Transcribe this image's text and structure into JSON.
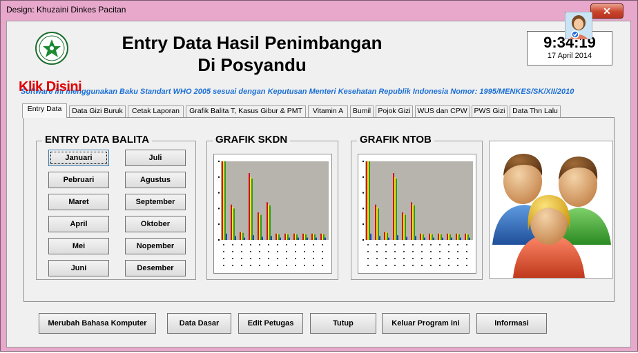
{
  "window": {
    "title": "Design: Khuzaini Dinkes Pacitan",
    "close_label": "✕"
  },
  "header": {
    "title_line1": "Entry Data Hasil Penimbangan",
    "title_line2": "Di Posyandu",
    "clock_time": "9:34:19",
    "clock_date": "17 April 2014"
  },
  "marquee": {
    "text": "Software ini menggunakan Baku Standart WHO 2005 sesuai dengan Keputusan Menteri Kesehatan Republik Indonesia Nomor: 1995/MENKES/SK/XII/2010"
  },
  "overlay": {
    "klik": "Klik Disini"
  },
  "tabs": [
    {
      "label": "Entry Data"
    },
    {
      "label": "Data Gizi Buruk"
    },
    {
      "label": "Cetak Laporan"
    },
    {
      "label": "Grafik Balita T, Kasus Gibur & PMT"
    },
    {
      "label": "Vitamin A"
    },
    {
      "label": "Bumil"
    },
    {
      "label": "Pojok Gizi"
    },
    {
      "label": "WUS dan CPW"
    },
    {
      "label": "PWS Gizi"
    },
    {
      "label": "Data Thn Lalu"
    }
  ],
  "entry": {
    "title": "ENTRY DATA BALITA",
    "months": [
      "Januari",
      "Pebruari",
      "Maret",
      "April",
      "Mei",
      "Juni",
      "Juli",
      "Agustus",
      "September",
      "Oktober",
      "Nopember",
      "Desember"
    ]
  },
  "charts": {
    "skdn_title": "GRAFIK SKDN",
    "ntob_title": "GRAFIK NTOB"
  },
  "chart_data": [
    {
      "type": "bar",
      "title": "GRAFIK SKDN",
      "categories": [
        "1",
        "2",
        "3",
        "4",
        "5",
        "6",
        "7",
        "8",
        "9",
        "10",
        "11",
        "12"
      ],
      "series": [
        {
          "values": [
            100,
            45,
            10,
            85,
            35,
            48,
            8,
            8,
            8,
            8,
            8,
            8
          ]
        },
        {
          "values": [
            100,
            42,
            10,
            80,
            33,
            45,
            8,
            8,
            8,
            8,
            8,
            8
          ]
        },
        {
          "values": [
            100,
            40,
            9,
            78,
            32,
            44,
            7,
            7,
            7,
            7,
            7,
            7
          ]
        },
        {
          "values": [
            8,
            5,
            3,
            6,
            4,
            5,
            3,
            3,
            3,
            3,
            3,
            3
          ]
        }
      ]
    },
    {
      "type": "bar",
      "title": "GRAFIK NTOB",
      "categories": [
        "1",
        "2",
        "3",
        "4",
        "5",
        "6",
        "7",
        "8",
        "9",
        "10",
        "11",
        "12"
      ],
      "series": [
        {
          "values": [
            100,
            45,
            10,
            85,
            35,
            48,
            8,
            8,
            8,
            8,
            8,
            8
          ]
        },
        {
          "values": [
            100,
            42,
            10,
            80,
            33,
            45,
            8,
            8,
            8,
            8,
            8,
            8
          ]
        },
        {
          "values": [
            100,
            40,
            9,
            78,
            32,
            44,
            7,
            7,
            7,
            7,
            7,
            7
          ]
        },
        {
          "values": [
            8,
            5,
            3,
            6,
            4,
            5,
            3,
            3,
            3,
            3,
            3,
            3
          ]
        }
      ]
    }
  ],
  "series_colors": [
    "#d41010",
    "#f2e21a",
    "#2a9a2a",
    "#2040c8"
  ],
  "bottom_buttons": [
    {
      "label": "Merubah Bahasa Komputer"
    },
    {
      "label": "Data Dasar"
    },
    {
      "label": "Edit Petugas"
    },
    {
      "label": "Tutup"
    },
    {
      "label": "Keluar Program ini"
    },
    {
      "label": "Informasi"
    }
  ]
}
